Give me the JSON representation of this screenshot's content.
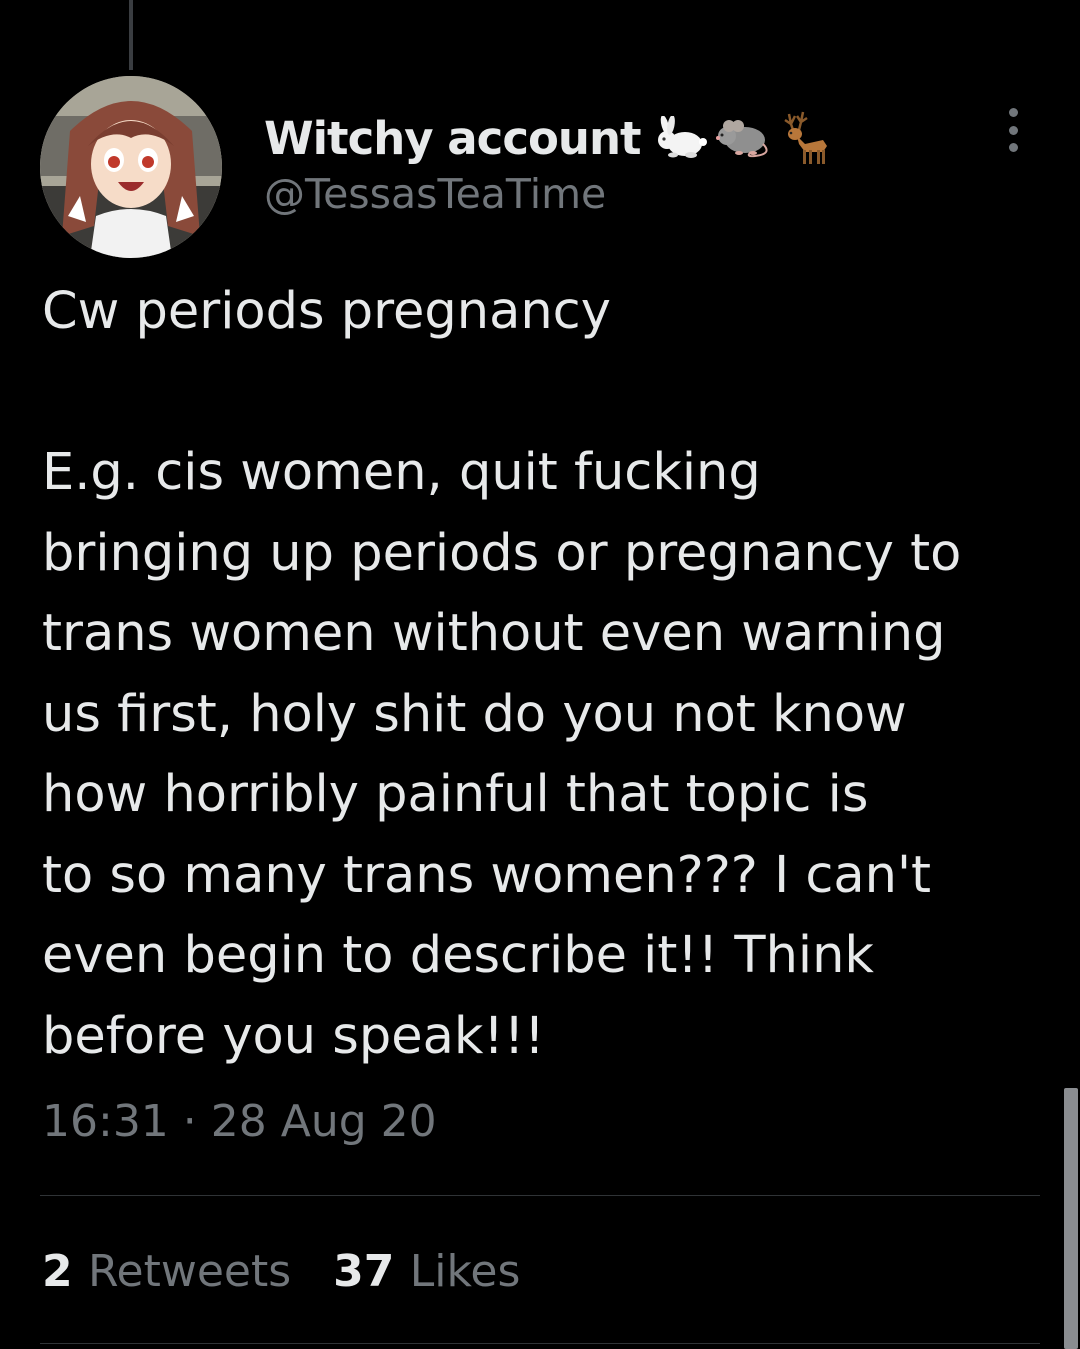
{
  "tweet": {
    "author": {
      "display_name": "Witchy account",
      "name_emojis": [
        "rabbit-emoji",
        "mouse-emoji",
        "deer-emoji"
      ],
      "handle": "@TessasTeaTime",
      "avatar_icon": "anime-girl-avatar"
    },
    "text_lines": [
      "Cw periods pregnancy",
      "",
      "E.g. cis women, quit fucking",
      "bringing up periods or pregnancy to",
      "trans women without even warning",
      "us first, holy shit do you not know",
      "how horribly painful that topic is",
      "to so many trans women??? I can't",
      "even begin to describe it!! Think",
      "before you speak!!!"
    ],
    "timestamp": "16:31 · 28 Aug 20",
    "stats": {
      "retweets_count": "2",
      "retweets_label": "Retweets",
      "likes_count": "37",
      "likes_label": "Likes"
    },
    "more_icon": "more-options-icon"
  },
  "colors": {
    "background": "#000000",
    "primary_text": "#e7e9ea",
    "secondary_text": "#71767b",
    "divider": "#2f3336"
  }
}
